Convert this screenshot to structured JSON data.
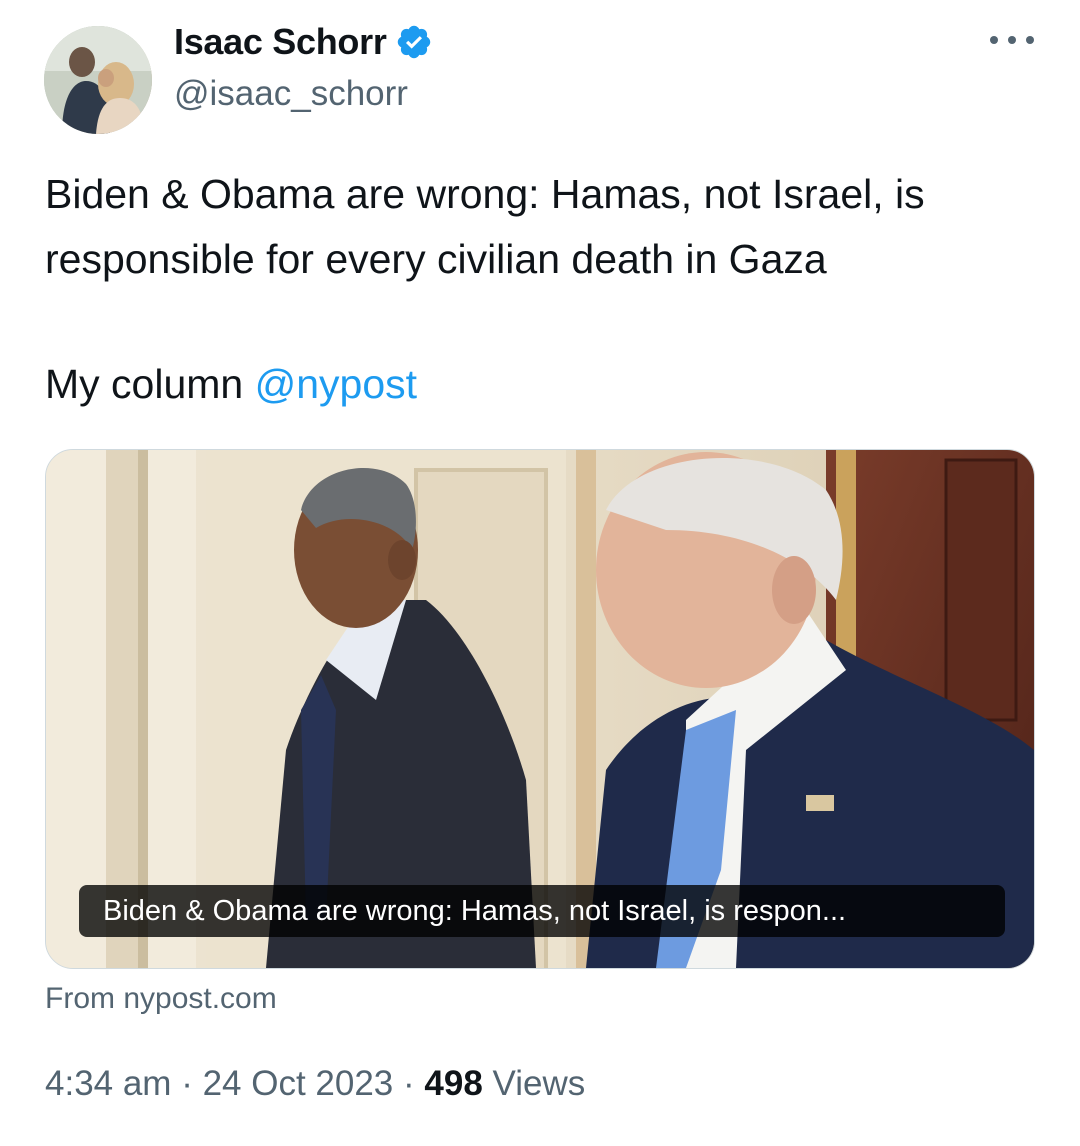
{
  "author": {
    "display_name": "Isaac Schorr",
    "handle": "@isaac_schorr",
    "verified": true
  },
  "tweet": {
    "text_main": "Biden & Obama are wrong: Hamas, not Israel, is responsible for every civilian death in Gaza",
    "text_second_prefix": "My column ",
    "mention": "@nypost"
  },
  "card": {
    "caption": "Biden & Obama are wrong: Hamas, not Israel, is respon...",
    "source": "From nypost.com"
  },
  "meta": {
    "time": "4:34 am",
    "separator": " · ",
    "date": "24 Oct 2023",
    "views_count": "498",
    "views_label": "Views"
  },
  "icons": {
    "verified": "verified-badge-icon",
    "more": "more-options-icon"
  },
  "colors": {
    "accent": "#1d9bf0",
    "secondary_text": "#536471",
    "primary_text": "#0f1419"
  }
}
